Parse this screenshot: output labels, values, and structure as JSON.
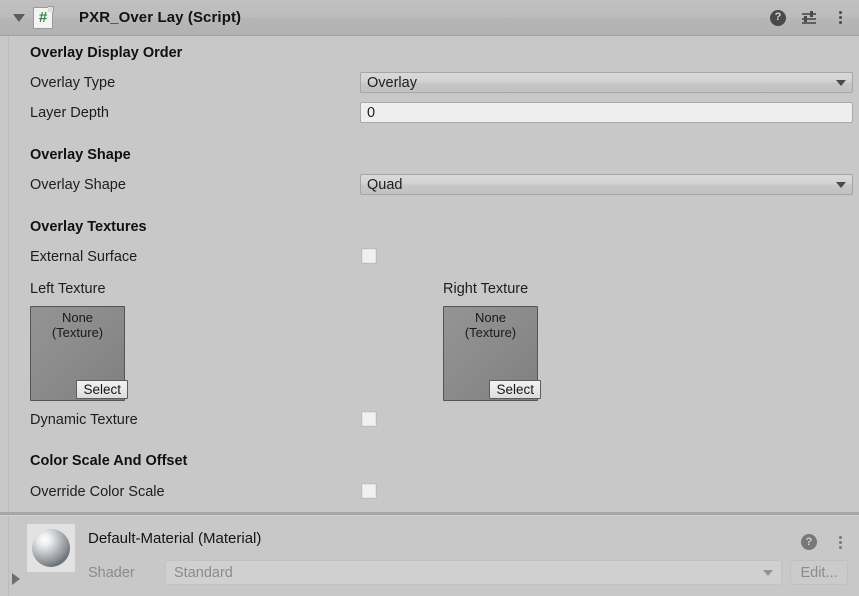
{
  "component": {
    "title": "PXR_Over Lay (Script)",
    "icon": "csharp-script-icon",
    "icon_glyph": "#",
    "foldout_expanded": true,
    "header_icons": [
      "help-icon",
      "preset-icon",
      "kebab-menu-icon"
    ]
  },
  "sections": [
    {
      "title": "Overlay Display Order"
    },
    {
      "title": "Overlay Shape"
    },
    {
      "title": "Overlay Textures"
    },
    {
      "title": "Color Scale And Offset"
    }
  ],
  "fields": {
    "overlay_type": {
      "label": "Overlay Type",
      "value": "Overlay",
      "type": "popup"
    },
    "layer_depth": {
      "label": "Layer Depth",
      "value": "0",
      "type": "number"
    },
    "overlay_shape": {
      "label": "Overlay Shape",
      "value": "Quad",
      "type": "popup"
    },
    "external_surface": {
      "label": "External Surface",
      "checked": false,
      "type": "checkbox"
    },
    "left_texture": {
      "label": "Left Texture",
      "value": "None",
      "value2": "(Texture)",
      "button": "Select",
      "type": "object"
    },
    "right_texture": {
      "label": "Right Texture",
      "value": "None",
      "value2": "(Texture)",
      "button": "Select",
      "type": "object"
    },
    "dynamic_texture": {
      "label": "Dynamic Texture",
      "checked": false,
      "type": "checkbox"
    },
    "override_color_scale": {
      "label": "Override Color Scale",
      "checked": false,
      "type": "checkbox"
    }
  },
  "material": {
    "title": "Default-Material (Material)",
    "foldout_expanded": false,
    "shader_label": "Shader",
    "shader_value": "Standard",
    "edit_label": "Edit...",
    "icons": [
      "help-icon",
      "kebab-menu-icon"
    ]
  },
  "colors": {
    "background": "#c8c8c8",
    "header": "#bcbcbc",
    "field_bg": "#eeeeee",
    "popup_bg": "#d2d2d2",
    "texture_bg": "#8a8a8a",
    "text": "#1d1d1d",
    "text_disabled": "#8b8b8b",
    "script_icon_green": "#2e8b45"
  }
}
